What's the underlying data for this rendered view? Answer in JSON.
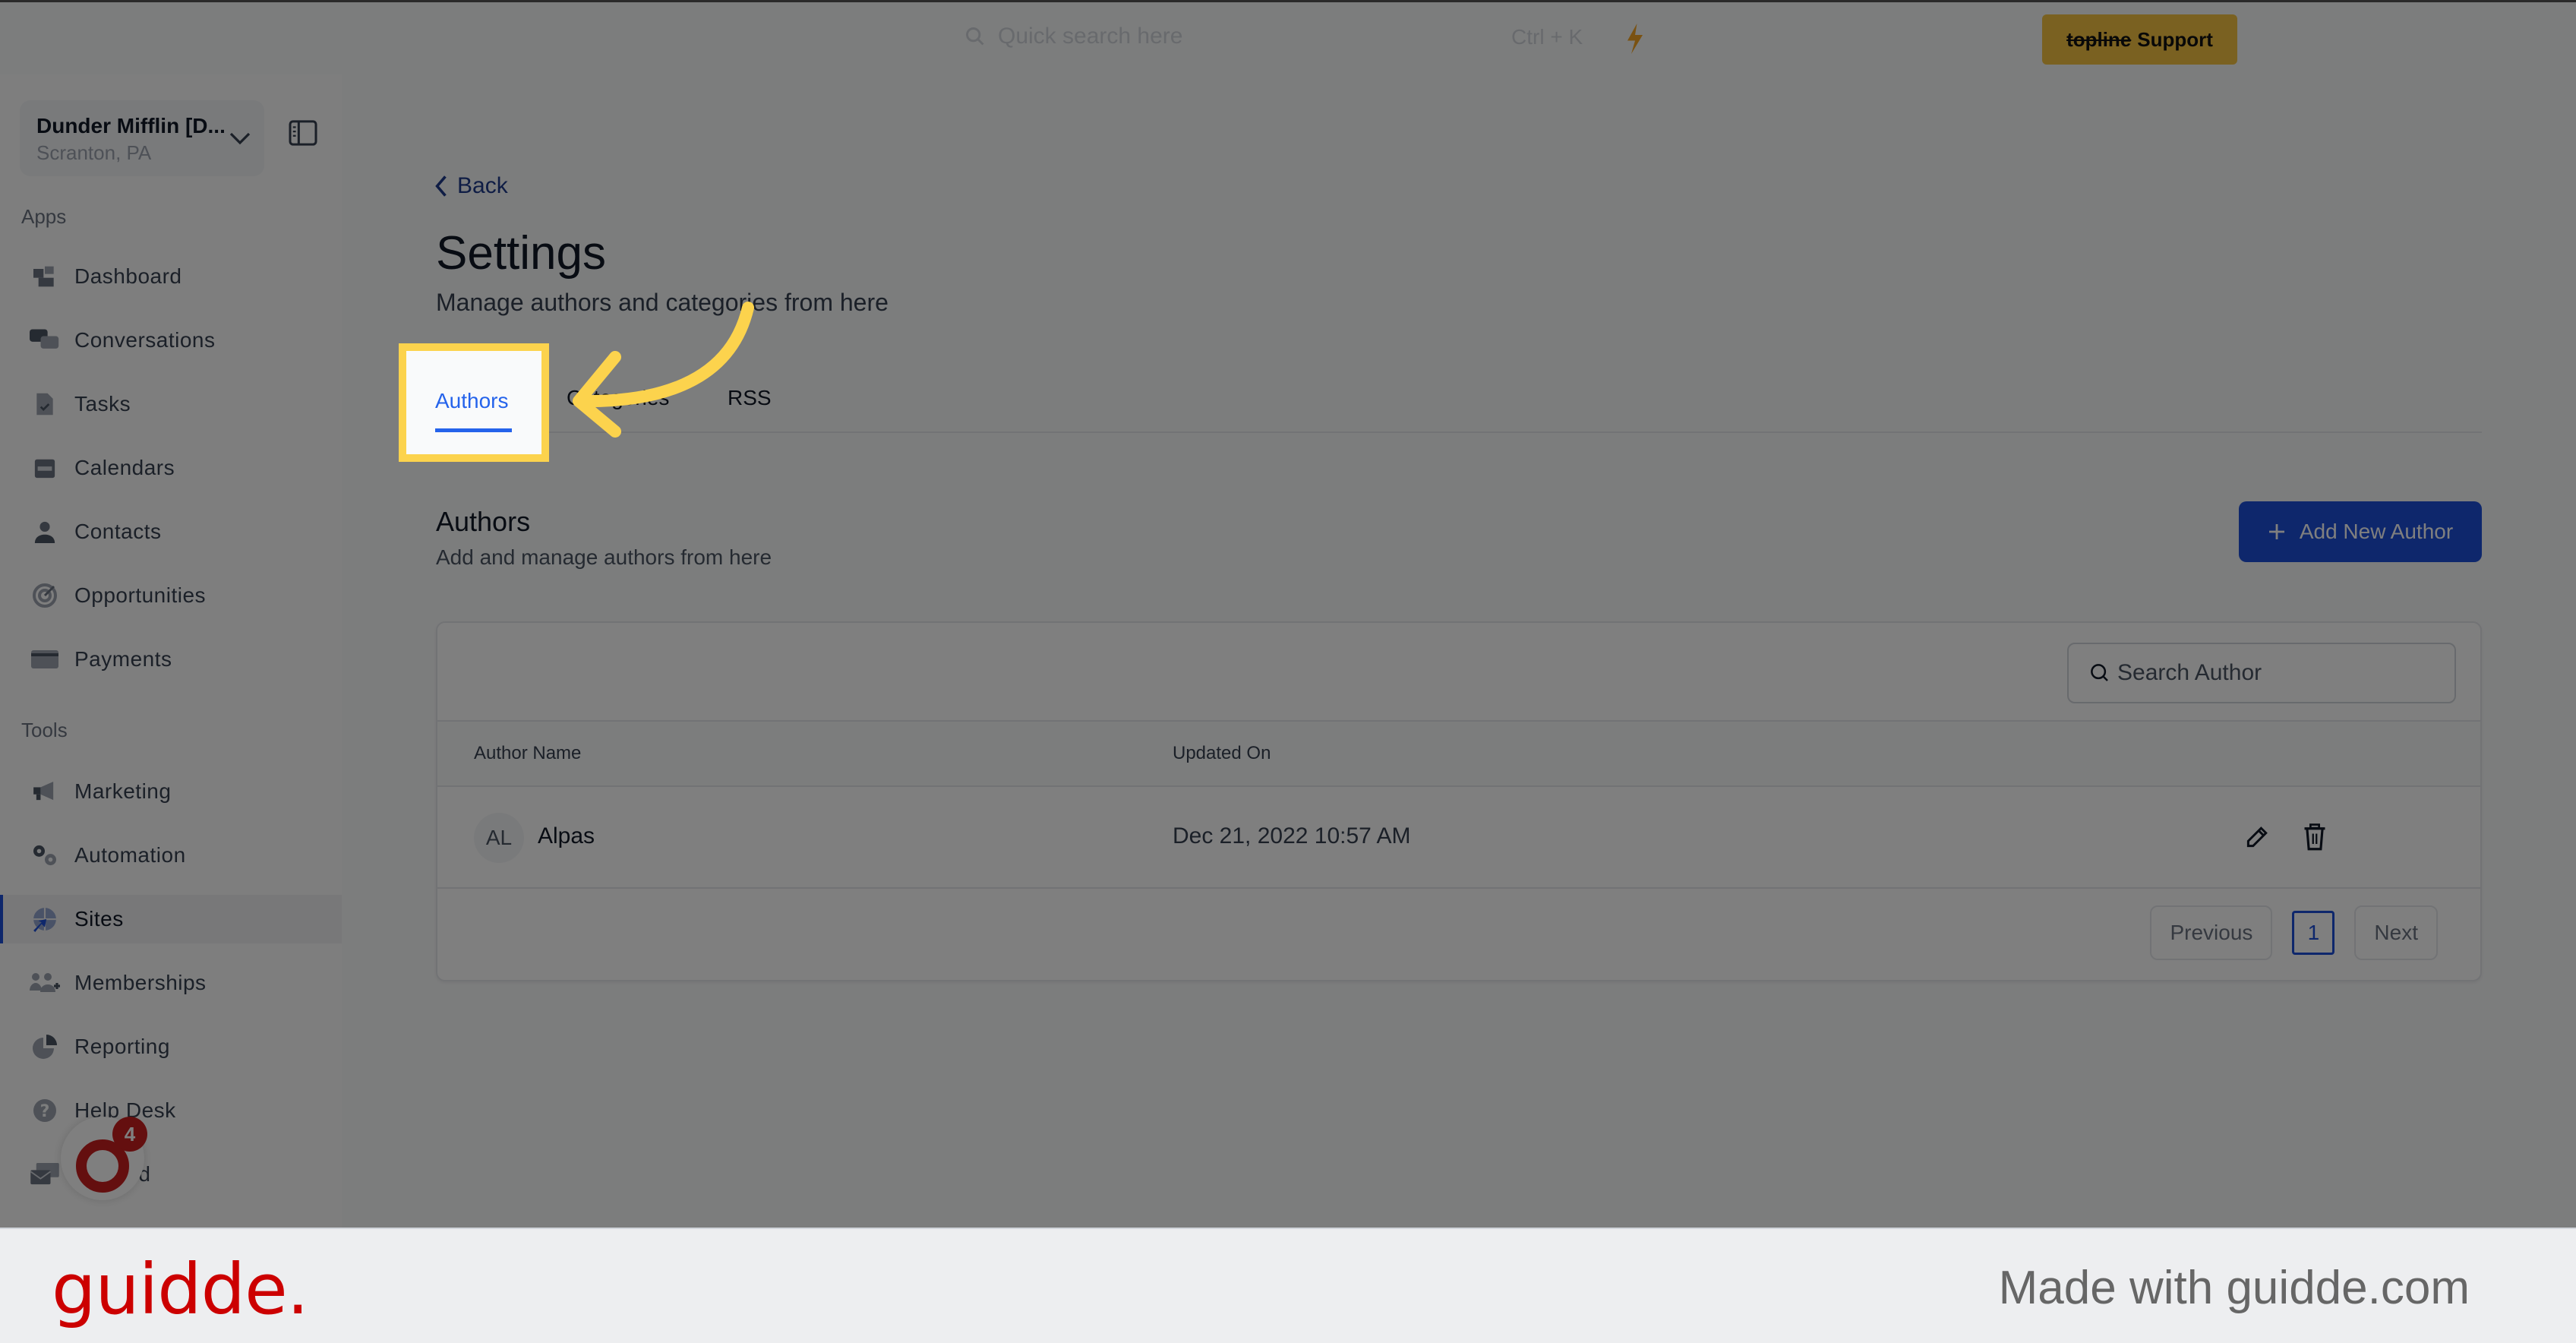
{
  "topbar": {
    "search_placeholder": "Quick search here",
    "shortcut": "Ctrl + K",
    "support_brand": "topline",
    "support_label": "Support"
  },
  "sidebar": {
    "account_name": "Dunder Mifflin [D...",
    "account_location": "Scranton, PA",
    "apps_label": "Apps",
    "tools_label": "Tools",
    "apps": [
      {
        "label": "Dashboard",
        "icon": "dashboard-icon"
      },
      {
        "label": "Conversations",
        "icon": "conversations-icon"
      },
      {
        "label": "Tasks",
        "icon": "tasks-icon"
      },
      {
        "label": "Calendars",
        "icon": "calendar-icon"
      },
      {
        "label": "Contacts",
        "icon": "contact-icon"
      },
      {
        "label": "Opportunities",
        "icon": "target-icon"
      },
      {
        "label": "Payments",
        "icon": "credit-card-icon"
      }
    ],
    "tools": [
      {
        "label": "Marketing",
        "icon": "megaphone-icon"
      },
      {
        "label": "Automation",
        "icon": "gears-icon"
      },
      {
        "label": "Sites",
        "icon": "globe-icon",
        "active": true
      },
      {
        "label": "Memberships",
        "icon": "users-plus-icon"
      },
      {
        "label": "Reporting",
        "icon": "pie-chart-icon"
      },
      {
        "label": "Help Desk",
        "icon": "help-icon"
      },
      {
        "label": "Mailfold",
        "icon": "mailfold-icon"
      }
    ],
    "chat_badge_count": "4"
  },
  "main": {
    "back_label": "Back",
    "title": "Settings",
    "subtitle": "Manage authors and categories from here",
    "tabs": [
      {
        "label": "Authors",
        "active": true
      },
      {
        "label": "Categories"
      },
      {
        "label": "RSS"
      }
    ],
    "section_title": "Authors",
    "section_subtitle": "Add and manage authors from here",
    "add_button_label": "Add New Author",
    "search_placeholder": "Search Author",
    "table": {
      "columns": [
        "Author Name",
        "Updated On"
      ],
      "rows": [
        {
          "initials": "AL",
          "name": "Alpas",
          "updated_on": "Dec 21, 2022 10:57 AM"
        }
      ]
    },
    "pagination": {
      "previous_label": "Previous",
      "current_page": "1",
      "next_label": "Next"
    }
  },
  "footer": {
    "logo": "guidde.",
    "tagline": "Made with guidde.com"
  },
  "colors": {
    "accent": "#2563eb",
    "primary_button": "#1d4ed8",
    "highlight": "#fcd34d",
    "support_button": "#f5c242",
    "brand_red": "#cc0000"
  }
}
